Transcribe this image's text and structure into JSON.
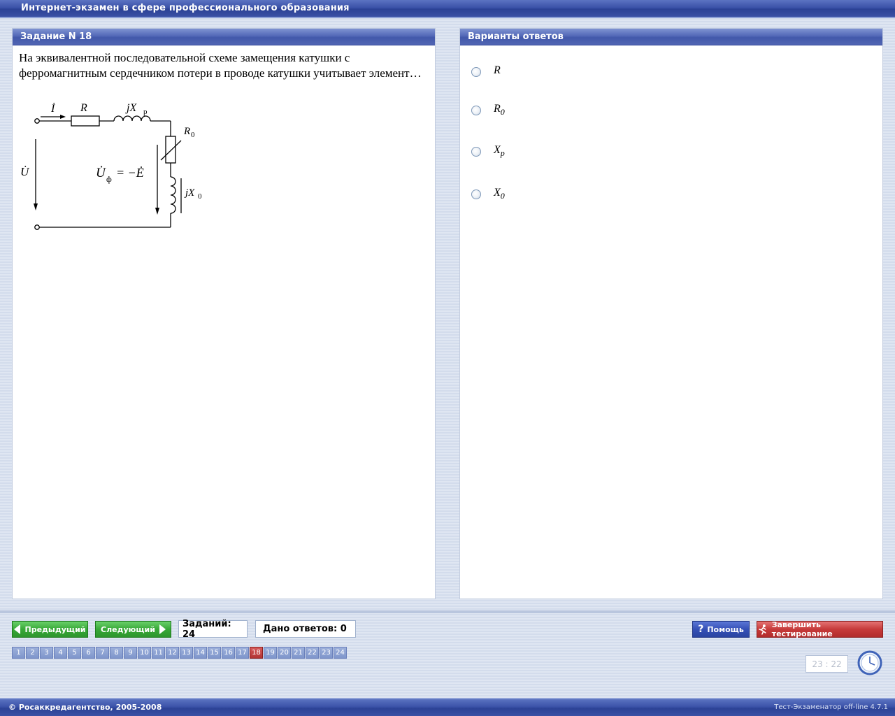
{
  "window": {
    "title": "Интернет-экзамен в сфере профессионального образования"
  },
  "question_panel": {
    "header": "Задание N 18",
    "text": "На эквивалентной последовательной схеме замещения катушки с ферромагнитным сердечником потери в проводе катушки учитывает элемент…",
    "circuit_labels": {
      "current": "İ",
      "R": "R",
      "jXp_base": "jX",
      "jXp_sub": "р",
      "R0_base": "R",
      "R0_sub": "0",
      "U": "U̇",
      "Uf_base": "U̇",
      "Uf_sub": "ф",
      "Uf_rhs": "= −Ė",
      "jX0_base": "jX",
      "jX0_sub": "0"
    }
  },
  "answers_panel": {
    "header": "Варианты ответов",
    "options": [
      {
        "base": "R",
        "sub": "",
        "selected": false
      },
      {
        "base": "R",
        "sub": "0",
        "selected": false
      },
      {
        "base": "X",
        "sub": "p",
        "selected": false
      },
      {
        "base": "X",
        "sub": "0",
        "selected": false
      }
    ]
  },
  "toolbar": {
    "prev_label": "Предыдущий",
    "next_label": "Следующий",
    "tasks_count": "Заданий: 24",
    "answers_given": "Дано ответов: 0",
    "help_label": "Помощь",
    "finish_label": "Завершить тестирование"
  },
  "pager": {
    "pages": [
      "1",
      "2",
      "3",
      "4",
      "5",
      "6",
      "7",
      "8",
      "9",
      "10",
      "11",
      "12",
      "13",
      "14",
      "15",
      "16",
      "17",
      "18",
      "19",
      "20",
      "21",
      "22",
      "23",
      "24"
    ],
    "current": "18"
  },
  "timer": {
    "value": "23 : 22"
  },
  "footer": {
    "left": "© Росаккредагентство, 2005-2008",
    "right": "Тест-Экзаменатор off-line 4.7.1"
  },
  "colors": {
    "title_bar": "#3b52a8",
    "panel_header": "#5369b8",
    "nav_button": "#38a838",
    "help_button": "#3550b6",
    "finish_button": "#c63a3a",
    "pager_current": "#b23434"
  }
}
